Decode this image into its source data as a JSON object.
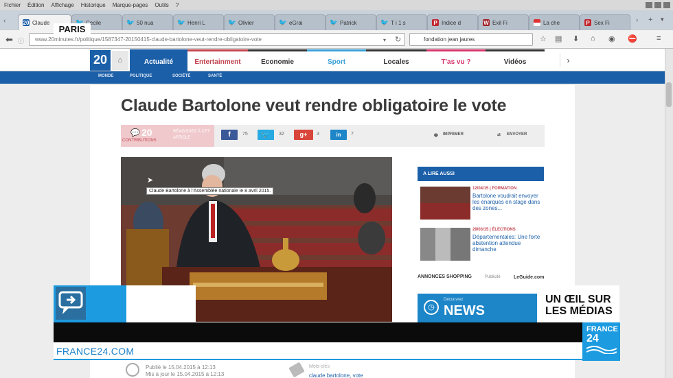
{
  "browser": {
    "menu": [
      "Fichier",
      "Édition",
      "Affichage",
      "Historique",
      "Marque-pages",
      "Outils",
      "?"
    ],
    "tabs": [
      {
        "label": "Claude",
        "icon": "20",
        "active": true
      },
      {
        "label": "Cecile",
        "icon": "tw"
      },
      {
        "label": "50 nua",
        "icon": "tw"
      },
      {
        "label": "Henri L",
        "icon": "tw"
      },
      {
        "label": "Olivier",
        "icon": "tw"
      },
      {
        "label": "eGrai",
        "icon": "tw"
      },
      {
        "label": "Patrick",
        "icon": "tw"
      },
      {
        "label": "T i 1 s",
        "icon": "tw"
      },
      {
        "label": "Indice d",
        "icon": "P"
      },
      {
        "label": "Exil Fi",
        "icon": "W"
      },
      {
        "label": "La che",
        "icon": "flag"
      },
      {
        "label": "Sex Fi",
        "icon": "P"
      }
    ],
    "url": "www.20minutes.fr/politique/1587347-20150415-claude-bartolone-veut-rendre-obligatoire-vote",
    "search_value": "fondation jean jaures"
  },
  "overlay_paris": "PARIS",
  "site": {
    "logo_text": "20",
    "nav": [
      "Actualité",
      "Entertainment",
      "Economie",
      "Sport",
      "Locales",
      "T'as vu ?",
      "Vidéos"
    ],
    "subnav": [
      "MONDE",
      "POLITIQUE",
      "SOCIÉTÉ",
      "SANTÉ"
    ],
    "headline": "Claude Bartolone veut rendre obligatoire le vote",
    "comments_count": "20",
    "comments_label": "CONTRIBUTIONS",
    "reagir_label": "RÉAGISSEZ À CET ARTICLE",
    "share": {
      "facebook_count": "75",
      "twitter_count": "32",
      "gplus_count": "3",
      "other_count": "7"
    },
    "print_label": "IMPRIMER",
    "send_label": "ENVOYER",
    "photo_caption": "Claude Bartolone à l'Assemblée nationale le 8 avril 2015.",
    "related": {
      "header": "A LIRE AUSSI",
      "items": [
        {
          "date": "12/04/15 | FORMATION",
          "text": "Bartolone voudrait envoyer les énarques en stage dans des zones..."
        },
        {
          "date": "29/03/15 | ÉLECTIONS",
          "text": "Départementales: Une forte abstention attendue dimanche"
        }
      ]
    },
    "shopping_label": "ANNONCES SHOPPING",
    "shopping_sub": "Publicité",
    "shopping_brand": "LeGuide.com",
    "news_ad_small": "Découvrez",
    "news_ad_big": "NEWS",
    "published": "Publié le 15.04.2015 à 12:13",
    "updated": "Mis à jour le 15.04.2015 à 12:13",
    "tags_label": "Mots-clés",
    "tags": "claude bartolone, vote"
  },
  "tv": {
    "show_title_line1": "UN ŒIL SUR",
    "show_title_line2": "LES MÉDIAS",
    "url": "FRANCE24.COM",
    "logo_line1": "FRANCE",
    "logo_line2": "24"
  }
}
